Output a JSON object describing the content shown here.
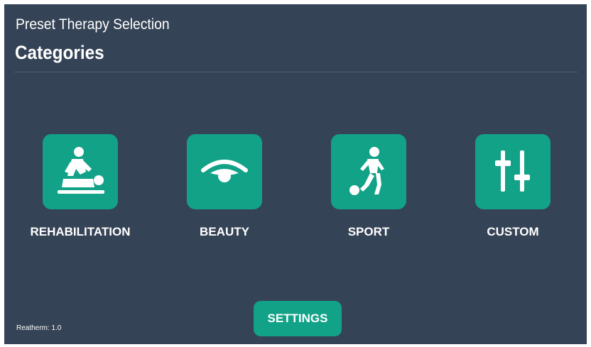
{
  "header": {
    "subtitle": "Preset Therapy Selection",
    "title": "Categories"
  },
  "categories": [
    {
      "label": "REHABILITATION",
      "icon": "massage-therapy-icon"
    },
    {
      "label": "BEAUTY",
      "icon": "eye-icon"
    },
    {
      "label": "SPORT",
      "icon": "soccer-player-icon"
    },
    {
      "label": "CUSTOM",
      "icon": "sliders-icon"
    }
  ],
  "footer": {
    "settings_label": "SETTINGS",
    "version": "Reatherm: 1.0"
  },
  "colors": {
    "background": "#354356",
    "accent": "#12a287",
    "text": "#ffffff"
  }
}
